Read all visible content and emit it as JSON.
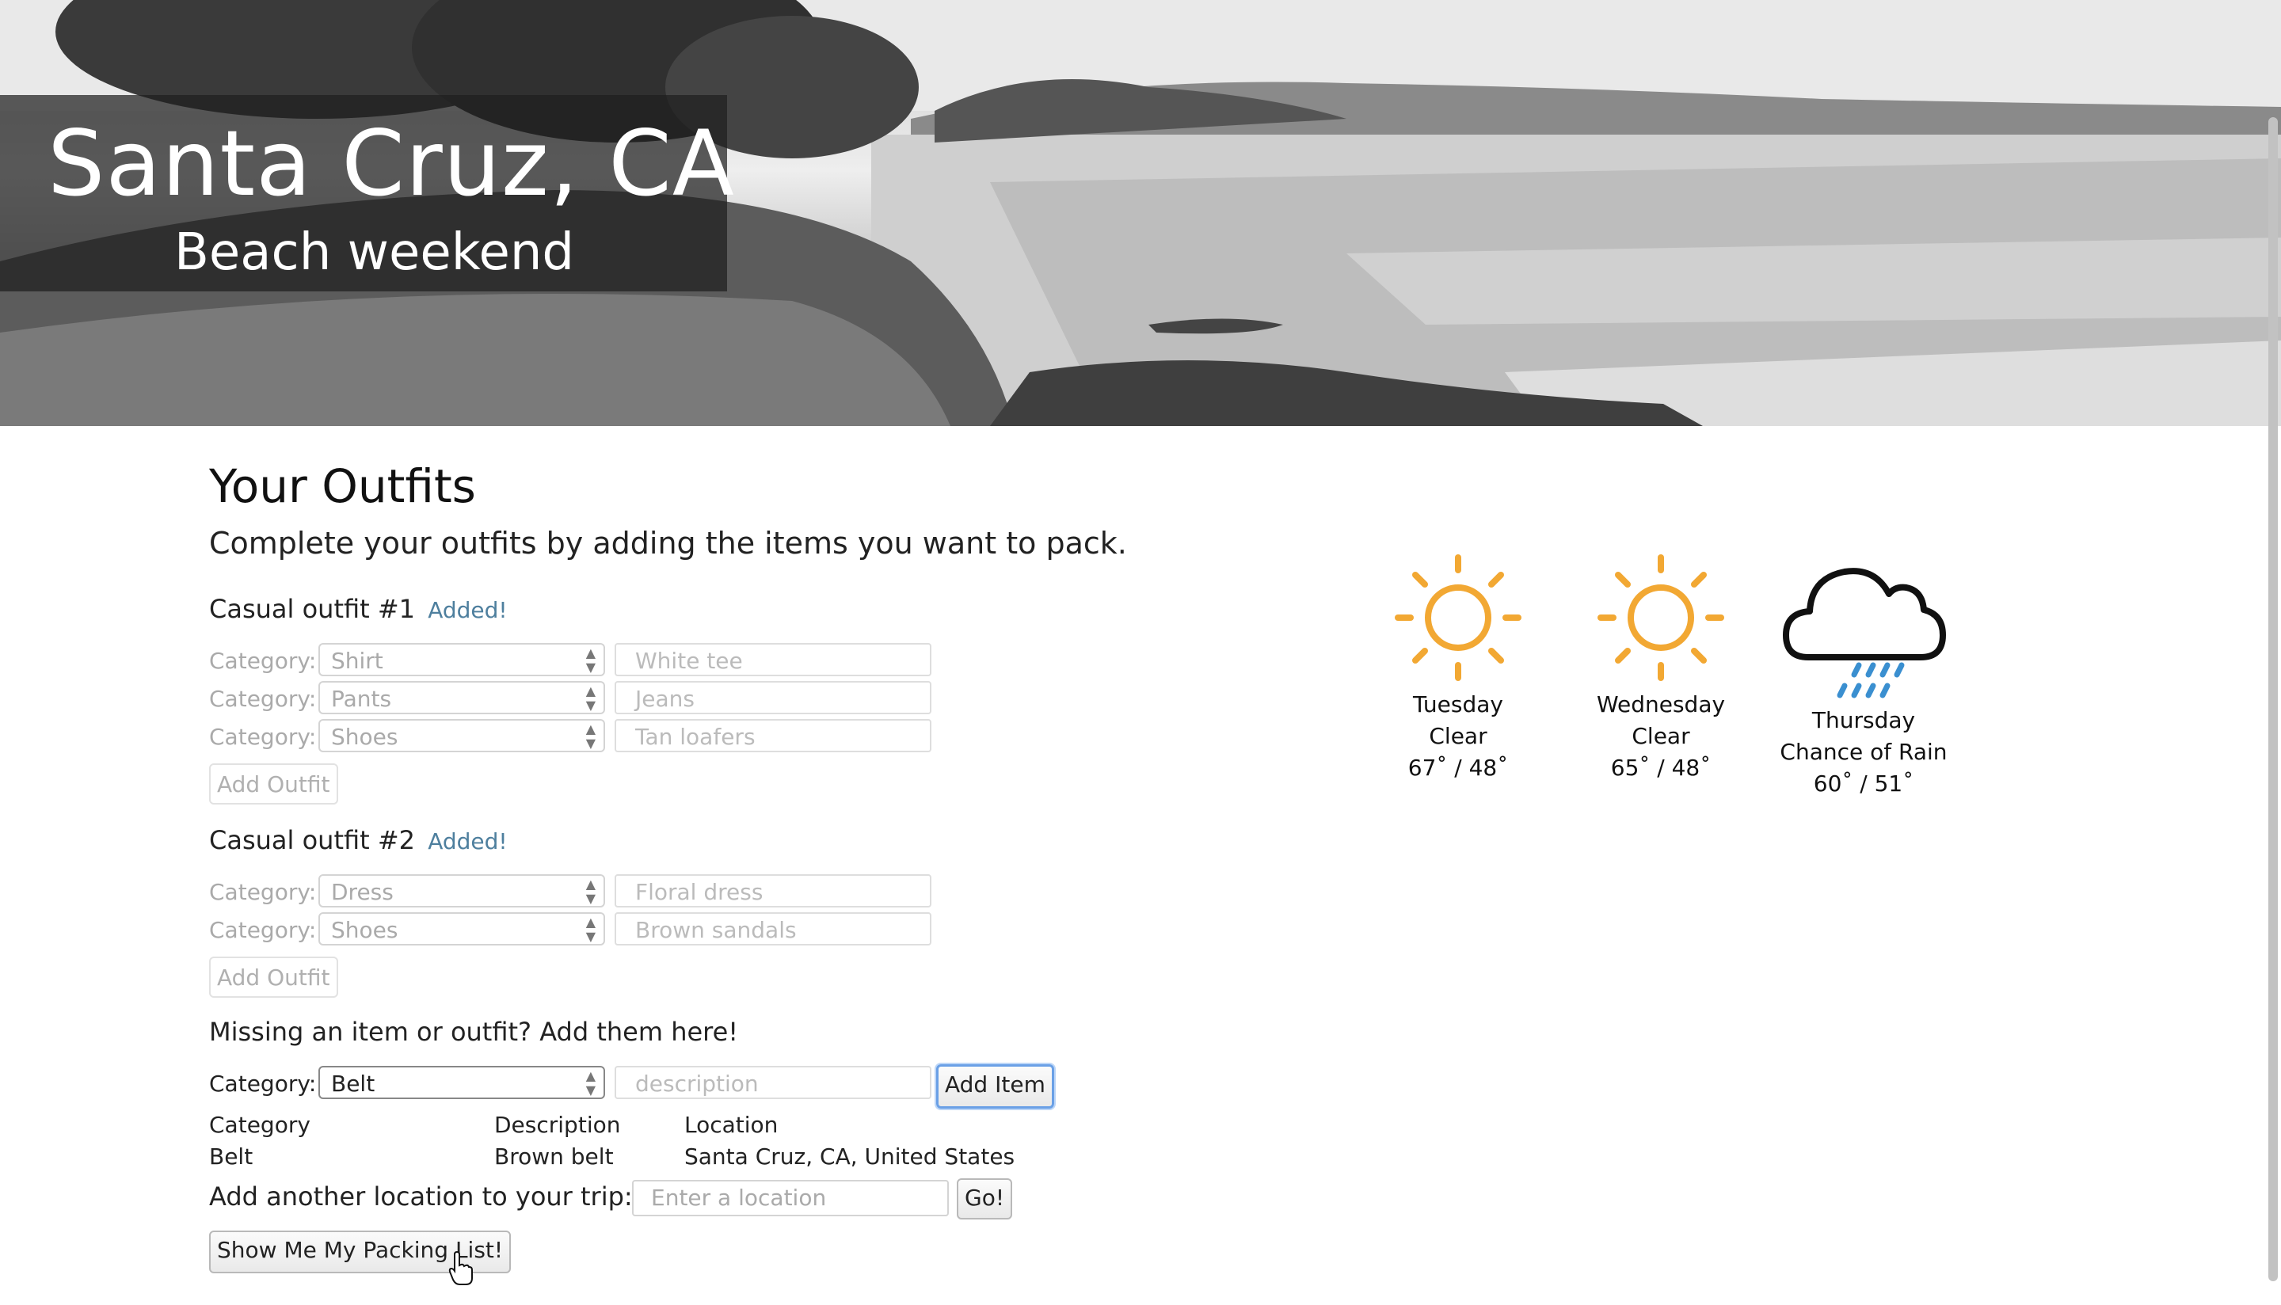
{
  "header": {
    "city": "Santa Cruz, CA",
    "trip_name": "Beach weekend"
  },
  "main": {
    "heading": "Your Outfits",
    "lead": "Complete your outfits by adding the items you want to pack.",
    "category_label": "Category:",
    "outfits": [
      {
        "title": "Casual outfit #1",
        "status": "Added!",
        "items": [
          {
            "category": "Shirt",
            "description": "White tee"
          },
          {
            "category": "Pants",
            "description": "Jeans"
          },
          {
            "category": "Shoes",
            "description": "Tan loafers"
          }
        ],
        "button": "Add Outfit"
      },
      {
        "title": "Casual outfit #2",
        "status": "Added!",
        "items": [
          {
            "category": "Dress",
            "description": "Floral dress"
          },
          {
            "category": "Shoes",
            "description": "Brown sandals"
          }
        ],
        "button": "Add Outfit"
      }
    ],
    "missing": {
      "heading": "Missing an item or outfit? Add them here!",
      "category_value": "Belt",
      "description_placeholder": "description",
      "add_button": "Add Item"
    },
    "items_table": {
      "headers": [
        "Category",
        "Description",
        "Location"
      ],
      "rows": [
        [
          "Belt",
          "Brown belt",
          "Santa Cruz, CA, United States"
        ]
      ]
    },
    "location": {
      "label": "Add another location to your trip:",
      "placeholder": "Enter a location",
      "go_button": "Go!"
    },
    "packing_button": "Show Me My Packing List!"
  },
  "weather": [
    {
      "day": "Tuesday",
      "condition": "Clear",
      "temps": "67˚ / 48˚",
      "icon": "sun-icon"
    },
    {
      "day": "Wednesday",
      "condition": "Clear",
      "temps": "65˚ / 48˚",
      "icon": "sun-icon"
    },
    {
      "day": "Thursday",
      "condition": "Chance of Rain",
      "temps": "60˚ / 51˚",
      "icon": "rain-cloud-icon"
    }
  ],
  "colors": {
    "sun": "#f2a833",
    "rain": "#3a8fd0",
    "added": "#4e7f9e",
    "focus": "#6aa0e6"
  }
}
